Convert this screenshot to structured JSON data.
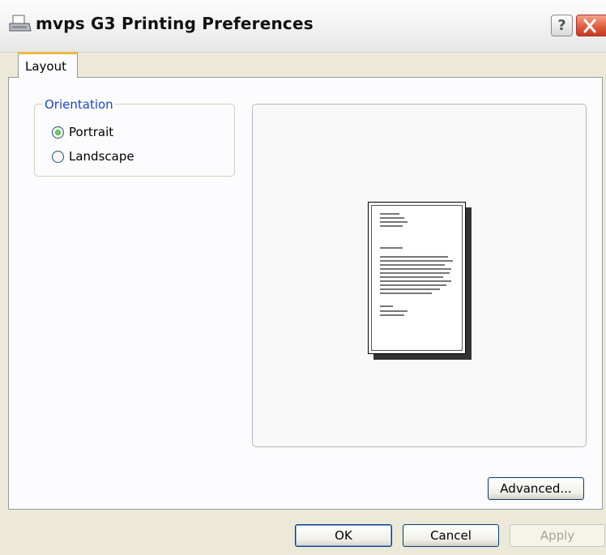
{
  "window": {
    "title": "mvps G3 Printing Preferences",
    "help_label": "?"
  },
  "tabs": [
    {
      "label": "Layout",
      "active": true
    }
  ],
  "orientation": {
    "legend": "Orientation",
    "options": [
      {
        "label": "Portrait",
        "checked": true
      },
      {
        "label": "Landscape",
        "checked": false
      }
    ]
  },
  "preview": {
    "orientation": "portrait"
  },
  "buttons": {
    "advanced": "Advanced...",
    "ok": "OK",
    "cancel": "Cancel",
    "apply": "Apply"
  },
  "colors": {
    "dialog_bg": "#ece9d8",
    "tab_accent": "#f0b840",
    "legend_text": "#1a44c8",
    "close_button": "#e0573a"
  }
}
